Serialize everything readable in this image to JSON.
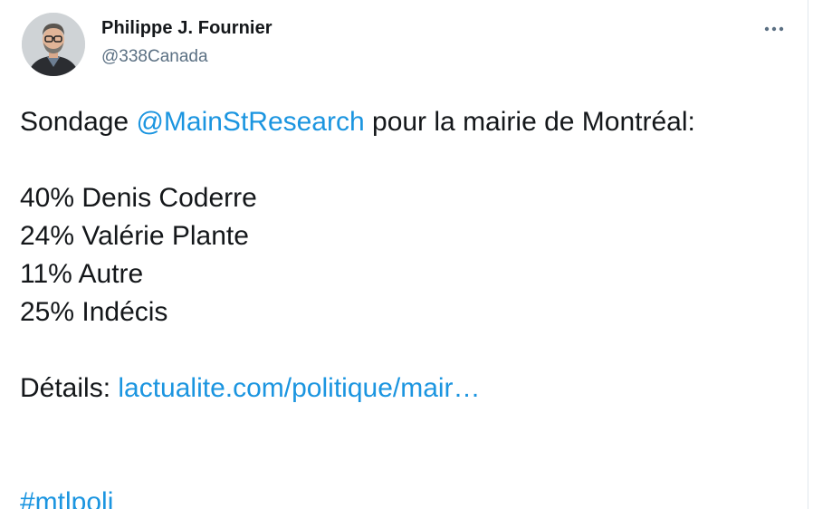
{
  "author": {
    "name": "Philippe J. Fournier",
    "handle": "@338Canada"
  },
  "menu": {
    "more_icon": "more-horizontal-icon"
  },
  "tweet": {
    "intro_text": "Sondage ",
    "mention": "@MainStResearch",
    "intro_rest": " pour la mairie de Montréal:",
    "results": [
      "40% Denis Coderre",
      "24% Valérie Plante",
      "11% Autre",
      "25% Indécis"
    ],
    "details_label": "Détails: ",
    "details_link": "lactualite.com/politique/mair…",
    "hashtag": "#mtlpoli"
  },
  "colors": {
    "link": "#1b95e0",
    "text": "#14171a",
    "secondary": "#5b7083"
  }
}
